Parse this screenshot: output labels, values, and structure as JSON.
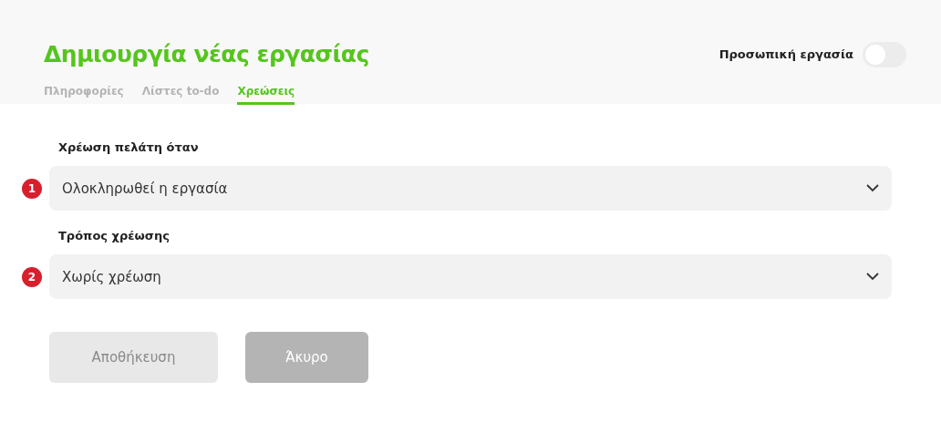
{
  "header": {
    "title": "Δημιουργία νέας εργασίας",
    "personal_task": {
      "label": "Προσωπική εργασία",
      "on": false
    }
  },
  "tabs": [
    {
      "label": "Πληροφορίες",
      "selected": false
    },
    {
      "label": "Λίστες to-do",
      "selected": false
    },
    {
      "label": "Χρεώσεις",
      "selected": true
    }
  ],
  "fields": [
    {
      "label": "Χρέωση πελάτη όταν",
      "badge": "1",
      "value": "Ολοκληρωθεί η εργασία"
    },
    {
      "label": "Τρόπος χρέωσης",
      "badge": "2",
      "value": "Χωρίς χρέωση"
    }
  ],
  "buttons": [
    {
      "label": "Αποθήκευση",
      "disabled": true
    },
    {
      "label": "Άκυρο",
      "disabled": false
    }
  ]
}
